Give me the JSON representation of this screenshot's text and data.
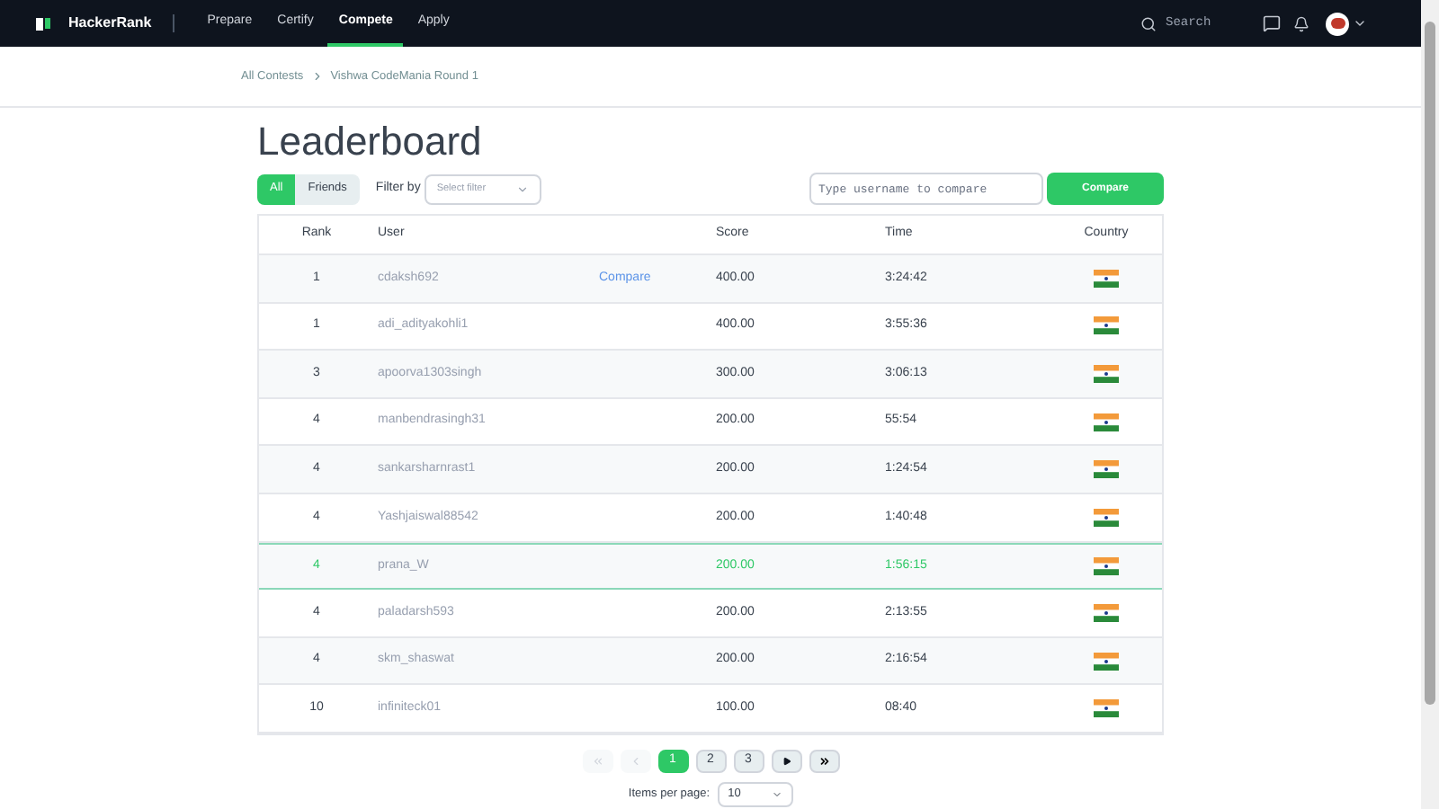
{
  "nav": {
    "brand": "HackerRank",
    "items": [
      {
        "label": "Prepare",
        "selected": false
      },
      {
        "label": "Certify",
        "selected": false
      },
      {
        "label": "Compete",
        "selected": true
      },
      {
        "label": "Apply",
        "selected": false
      }
    ],
    "search": {
      "placeholder": "Search"
    }
  },
  "breadcrumb": [
    "All Contests",
    "Vishwa CodeMania Round 1"
  ],
  "title": "Leaderboard",
  "toggle": [
    {
      "label": "All",
      "selected": true
    },
    {
      "label": "Friends",
      "selected": false
    }
  ],
  "filter": {
    "label": "Filter by",
    "placeholder": "Select filter"
  },
  "compare": {
    "placeholder": "Type username to compare",
    "button": "Compare"
  },
  "table": {
    "columns": [
      "Rank",
      "User",
      "Score",
      "Time",
      "Country"
    ],
    "rows": [
      {
        "rank": "1",
        "user": "cdaksh692",
        "action": "Compare",
        "score": "400.00",
        "time": "3:24:42",
        "highlighted": false
      },
      {
        "rank": "1",
        "user": "adi_adityakohli1",
        "score": "400.00",
        "time": "3:55:36",
        "highlighted": false
      },
      {
        "rank": "3",
        "user": "apoorva1303singh",
        "score": "300.00",
        "time": "3:06:13",
        "highlighted": false
      },
      {
        "rank": "4",
        "user": "manbendrasingh31",
        "score": "200.00",
        "time": "55:54",
        "highlighted": false
      },
      {
        "rank": "4",
        "user": "sankarsharnrast1",
        "score": "200.00",
        "time": "1:24:54",
        "highlighted": false
      },
      {
        "rank": "4",
        "user": "Yashjaiswal88542",
        "score": "200.00",
        "time": "1:40:48",
        "highlighted": false
      },
      {
        "rank": "4",
        "user": "prana_W",
        "score": "200.00",
        "time": "1:56:15",
        "highlighted": true
      },
      {
        "rank": "4",
        "user": "paladarsh593",
        "score": "200.00",
        "time": "2:13:55",
        "highlighted": false
      },
      {
        "rank": "4",
        "user": "skm_shaswat",
        "score": "200.00",
        "time": "2:16:54",
        "highlighted": false
      },
      {
        "rank": "10",
        "user": "infiniteck01",
        "score": "100.00",
        "time": "08:40",
        "highlighted": false
      }
    ]
  },
  "pagination": {
    "first_disabled": true,
    "prev_disabled": true,
    "pages": [
      {
        "label": "1",
        "selected": true
      },
      {
        "label": "2",
        "selected": false
      },
      {
        "label": "3",
        "selected": false
      }
    ]
  },
  "items_per_page": {
    "label": "Items per page:",
    "value": "10"
  }
}
